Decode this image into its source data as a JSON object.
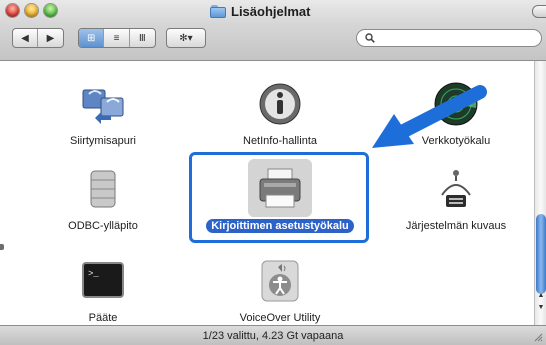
{
  "window": {
    "title": "Lisäohjelmat"
  },
  "toolbar": {
    "back": "◀",
    "forward": "▶",
    "view_icon": "⊞",
    "view_list": "≡",
    "view_columns": "Ⅲ",
    "action": "✻▾",
    "search_placeholder": ""
  },
  "apps": [
    {
      "label": "Siirtymisapuri",
      "icon": "migration-assistant-icon"
    },
    {
      "label": "NetInfo-hallinta",
      "icon": "netinfo-manager-icon"
    },
    {
      "label": "Verkkotyökalu",
      "icon": "network-utility-icon"
    },
    {
      "label": "ODBC-ylläpito",
      "icon": "odbc-administrator-icon"
    },
    {
      "label": "Kirjoittimen asetustyökalu",
      "icon": "printer-setup-utility-icon",
      "selected": true
    },
    {
      "label": "Järjestelmän kuvaus",
      "icon": "system-profiler-icon"
    },
    {
      "label": "Pääte",
      "icon": "terminal-icon"
    },
    {
      "label": "VoiceOver Utility",
      "icon": "voiceover-utility-icon"
    }
  ],
  "status": {
    "text": "1/23 valittu, 4.23 Gt vapaana"
  },
  "colors": {
    "selection": "#2d62c9",
    "annotation": "#1d6ed8"
  }
}
